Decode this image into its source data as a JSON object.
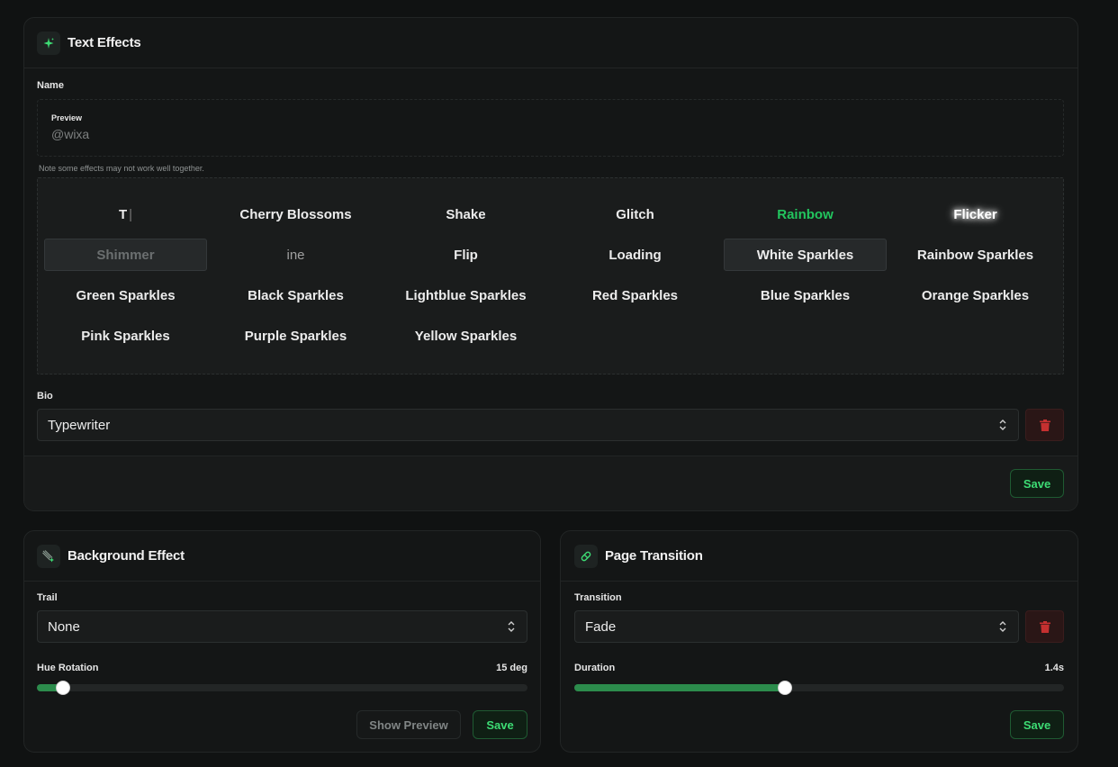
{
  "text_effects": {
    "title": "Text Effects",
    "icon": "sparkles-icon",
    "name_label": "Name",
    "preview_label": "Preview",
    "preview_text": "@wixa",
    "note": "Note some effects may not work well together.",
    "effects": [
      "T",
      "Cherry Blossoms",
      "Shake",
      "Glitch",
      "Rainbow",
      "Flicker",
      "Shimmer",
      "ine",
      "Flip",
      "Loading",
      "White Sparkles",
      "Rainbow Sparkles",
      "Green Sparkles",
      "Black Sparkles",
      "Lightblue Sparkles",
      "Red Sparkles",
      "Blue Sparkles",
      "Orange Sparkles",
      "Pink Sparkles",
      "Purple Sparkles",
      "Yellow Sparkles"
    ],
    "selected_effects": [
      "Shimmer",
      "White Sparkles"
    ],
    "bio_label": "Bio",
    "bio_value": "Typewriter",
    "save_label": "Save"
  },
  "background_effect": {
    "title": "Background Effect",
    "icon": "meteor-icon",
    "trail_label": "Trail",
    "trail_value": "None",
    "hue_label": "Hue Rotation",
    "hue_value": "15 deg",
    "hue_fraction": 0.053,
    "preview_label": "Show Preview",
    "save_label": "Save"
  },
  "page_transition": {
    "title": "Page Transition",
    "icon": "pill-icon",
    "transition_label": "Transition",
    "transition_value": "Fade",
    "duration_label": "Duration",
    "duration_value": "1.4s",
    "duration_fraction": 0.43,
    "save_label": "Save"
  },
  "colors": {
    "accent": "#3ddc74",
    "danger": "#c53030"
  }
}
